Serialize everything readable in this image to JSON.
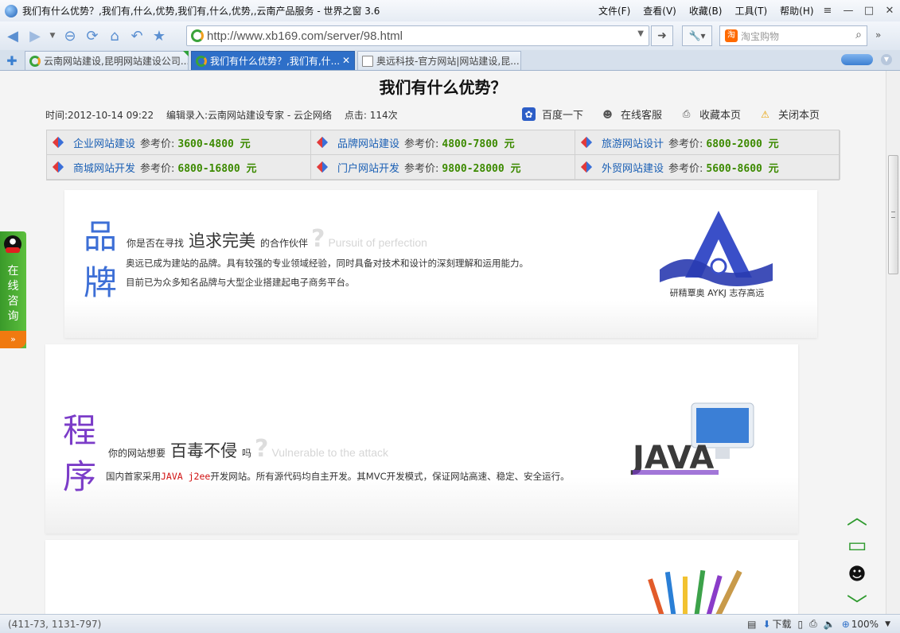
{
  "window": {
    "title": "我们有什么优势？,我们有,什么,优势,我们有,什么,优势,,云南产品服务 - 世界之窗 3.6",
    "menu": [
      "文件(F)",
      "查看(V)",
      "收藏(B)",
      "工具(T)",
      "帮助(H)"
    ]
  },
  "toolbar": {
    "url": "http://www.xb169.com/server/98.html",
    "search_placeholder": "淘宝购物",
    "search_logo": "淘"
  },
  "tabs": [
    {
      "label": "云南网站建设,昆明网站建设公司...",
      "active": false
    },
    {
      "label": "我们有什么优势？,我们有,什...",
      "active": true
    },
    {
      "label": "奥远科技-官方网站|网站建设,昆...",
      "active": false
    }
  ],
  "article": {
    "title": "我们有什么优势？",
    "time": "时间:2012-10-14 09:22",
    "editor": "编辑录入:云南网站建设专家 - 云企网络",
    "clicks": "点击: 114次",
    "actions": [
      "百度一下",
      "在线客服",
      "收藏本页",
      "关闭本页"
    ]
  },
  "services": [
    {
      "name": "企业网站建设",
      "ref": "参考价:",
      "price": "3600-4800 元"
    },
    {
      "name": "品牌网站建设",
      "ref": "参考价:",
      "price": "4800-7800 元"
    },
    {
      "name": "旅游网站设计",
      "ref": "参考价:",
      "price": "6800-2000 元"
    },
    {
      "name": "商城网站开发",
      "ref": "参考价:",
      "price": "6800-16800 元"
    },
    {
      "name": "门户网站开发",
      "ref": "参考价:",
      "price": "9800-28000 元"
    },
    {
      "name": "外贸网站建设",
      "ref": "参考价:",
      "price": "5600-8600 元"
    }
  ],
  "brand": {
    "char1": "品",
    "char2": "牌",
    "pre": "你是否在寻找",
    "highlight": "追求完美",
    "post": "的合作伙伴",
    "qmark": "?",
    "english": "Pursuit of perfection",
    "line1": "奥远已成为建站的品牌。具有较强的专业领域经验，同时具备对技术和设计的深刻理解和运用能力。",
    "line2": "目前已为众多知名品牌与大型企业搭建起电子商务平台。",
    "logo_text": "研精覃奥  AYKJ  志存高远",
    "logo_letter": "A"
  },
  "program": {
    "char1": "程",
    "char2": "序",
    "pre": "你的网站想要",
    "highlight": "百毒不侵",
    "post": "吗",
    "qmark": "?",
    "english": "Vulnerable to the attack",
    "line_a": "国内首家采用",
    "line_red": "JAVA j2ee",
    "line_b": "开发网站。所有源代码均自主开发。其MVC开发模式，保证网站高速、稳定、安全运行。",
    "logo_text": "JAVA"
  },
  "consult": {
    "text": "在线咨询",
    "more": "»"
  },
  "status": {
    "coords": "(411-73, 1131-797)",
    "download": "下载",
    "zoom": "100%"
  }
}
